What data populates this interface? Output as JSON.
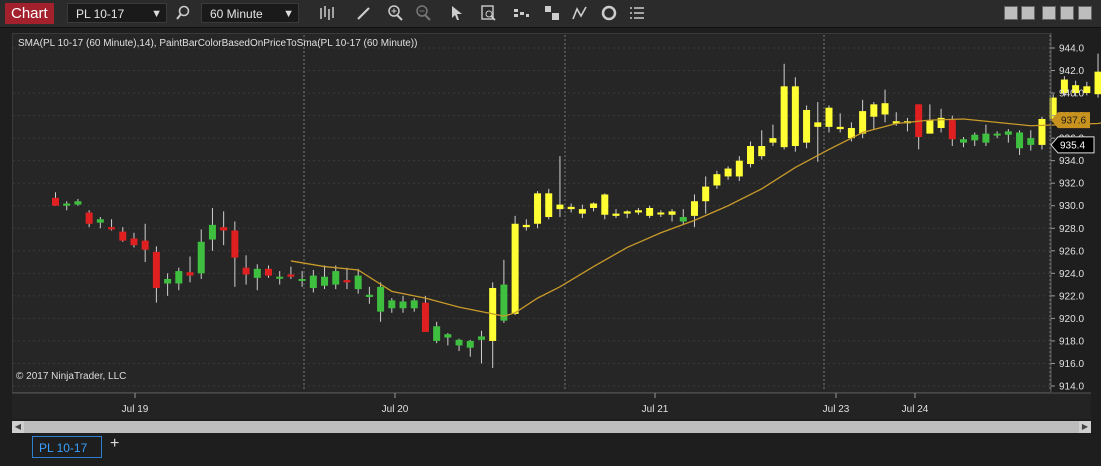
{
  "window": {
    "tab_label": "Chart"
  },
  "toolbar": {
    "instrument": "PL 10-17",
    "interval": "60 Minute",
    "icons": [
      "search-icon",
      "bar-style-icon",
      "draw-pencil-icon",
      "zoom-in-icon",
      "zoom-out-icon",
      "pointer-icon",
      "data-box-icon",
      "indicators-icon",
      "strategies-icon",
      "drawing-tools-icon",
      "properties-icon",
      "list-icon"
    ]
  },
  "chart": {
    "indicator_label": "SMA(PL 10-17 (60 Minute),14), PaintBarColorBasedOnPriceToSma(PL 10-17 (60 Minute))",
    "copyright": "© 2017 NinjaTrader, LLC",
    "y_ticks": [
      "944.0",
      "942.0",
      "940.0",
      "938.0",
      "936.0",
      "934.0",
      "932.0",
      "930.0",
      "928.0",
      "926.0",
      "924.0",
      "922.0",
      "920.0",
      "918.0",
      "916.0",
      "914.0"
    ],
    "x_labels": [
      "Jul 19",
      "Jul 20",
      "Jul 21",
      "Jul 23",
      "Jul 24"
    ],
    "sma_marker": "937.6",
    "last_price": "935.4",
    "colors": {
      "up": "#3fbf3f",
      "down": "#e02020",
      "above_sma": "#ffff33",
      "sma": "#c89a2a",
      "sma_marker_bg": "#c8921e",
      "last_price_bg": "#000000"
    }
  },
  "chart_data": {
    "type": "candlestick",
    "x": [
      "Jul 19",
      "Jul 20",
      "Jul 21",
      "Jul 23",
      "Jul 24"
    ],
    "ylim": [
      914,
      945
    ],
    "sma_period": 14,
    "last_price": 935.4,
    "sma_last": 937.6,
    "candles": [
      {
        "o": 930.7,
        "h": 931.2,
        "l": 930.0,
        "c": 930.0,
        "col": "down"
      },
      {
        "o": 930.0,
        "h": 930.4,
        "l": 929.6,
        "c": 930.2,
        "col": "up"
      },
      {
        "o": 930.1,
        "h": 930.6,
        "l": 930.0,
        "c": 930.4,
        "col": "up"
      },
      {
        "o": 929.4,
        "h": 929.6,
        "l": 928.1,
        "c": 928.4,
        "col": "down"
      },
      {
        "o": 928.5,
        "h": 929.0,
        "l": 928.0,
        "c": 928.8,
        "col": "up"
      },
      {
        "o": 928.1,
        "h": 928.8,
        "l": 927.8,
        "c": 927.9,
        "col": "down"
      },
      {
        "o": 927.7,
        "h": 928.1,
        "l": 926.8,
        "c": 926.9,
        "col": "down"
      },
      {
        "o": 927.1,
        "h": 927.6,
        "l": 926.3,
        "c": 926.5,
        "col": "down"
      },
      {
        "o": 926.9,
        "h": 928.4,
        "l": 925.0,
        "c": 926.1,
        "col": "down"
      },
      {
        "o": 925.9,
        "h": 926.4,
        "l": 921.4,
        "c": 922.7,
        "col": "down"
      },
      {
        "o": 923.1,
        "h": 924.0,
        "l": 922.0,
        "c": 923.5,
        "col": "up"
      },
      {
        "o": 923.1,
        "h": 924.5,
        "l": 922.5,
        "c": 924.2,
        "col": "up"
      },
      {
        "o": 924.1,
        "h": 925.5,
        "l": 923.2,
        "c": 923.8,
        "col": "down"
      },
      {
        "o": 924.0,
        "h": 927.9,
        "l": 923.5,
        "c": 926.8,
        "col": "up"
      },
      {
        "o": 927.0,
        "h": 929.8,
        "l": 926.0,
        "c": 928.3,
        "col": "up"
      },
      {
        "o": 928.1,
        "h": 929.5,
        "l": 926.5,
        "c": 927.8,
        "col": "down"
      },
      {
        "o": 927.8,
        "h": 928.6,
        "l": 922.8,
        "c": 925.4,
        "col": "down"
      },
      {
        "o": 924.5,
        "h": 925.6,
        "l": 923.0,
        "c": 923.9,
        "col": "down"
      },
      {
        "o": 923.6,
        "h": 924.8,
        "l": 922.5,
        "c": 924.4,
        "col": "up"
      },
      {
        "o": 924.4,
        "h": 924.7,
        "l": 923.6,
        "c": 923.8,
        "col": "down"
      },
      {
        "o": 923.6,
        "h": 924.2,
        "l": 923.0,
        "c": 923.7,
        "col": "up"
      },
      {
        "o": 923.9,
        "h": 924.6,
        "l": 923.5,
        "c": 923.7,
        "col": "down"
      },
      {
        "o": 923.5,
        "h": 924.2,
        "l": 922.8,
        "c": 923.4,
        "col": "up"
      },
      {
        "o": 922.7,
        "h": 924.3,
        "l": 922.3,
        "c": 923.8,
        "col": "up"
      },
      {
        "o": 922.9,
        "h": 924.7,
        "l": 922.6,
        "c": 923.7,
        "col": "up"
      },
      {
        "o": 923.0,
        "h": 924.7,
        "l": 922.6,
        "c": 924.2,
        "col": "up"
      },
      {
        "o": 923.2,
        "h": 924.5,
        "l": 922.6,
        "c": 923.4,
        "col": "down"
      },
      {
        "o": 922.6,
        "h": 924.4,
        "l": 922.2,
        "c": 923.8,
        "col": "up"
      },
      {
        "o": 921.9,
        "h": 922.8,
        "l": 921.3,
        "c": 922.1,
        "col": "up"
      },
      {
        "o": 920.6,
        "h": 923.2,
        "l": 919.7,
        "c": 922.8,
        "col": "up"
      },
      {
        "o": 920.9,
        "h": 921.8,
        "l": 920.5,
        "c": 921.6,
        "col": "up"
      },
      {
        "o": 920.9,
        "h": 922.0,
        "l": 920.5,
        "c": 921.5,
        "col": "up"
      },
      {
        "o": 920.9,
        "h": 921.8,
        "l": 920.6,
        "c": 921.6,
        "col": "up"
      },
      {
        "o": 921.4,
        "h": 922.0,
        "l": 919.2,
        "c": 918.8,
        "col": "down"
      },
      {
        "o": 918.0,
        "h": 919.7,
        "l": 917.8,
        "c": 919.3,
        "col": "up"
      },
      {
        "o": 918.3,
        "h": 918.7,
        "l": 917.6,
        "c": 918.6,
        "col": "up"
      },
      {
        "o": 917.6,
        "h": 918.2,
        "l": 917.1,
        "c": 918.1,
        "col": "up"
      },
      {
        "o": 917.4,
        "h": 918.1,
        "l": 916.6,
        "c": 918.0,
        "col": "up"
      },
      {
        "o": 918.1,
        "h": 918.9,
        "l": 916.0,
        "c": 918.4,
        "col": "up"
      },
      {
        "o": 918.0,
        "h": 923.2,
        "l": 915.6,
        "c": 922.7,
        "col": "above"
      },
      {
        "o": 919.8,
        "h": 925.2,
        "l": 919.6,
        "c": 923.0,
        "col": "up"
      },
      {
        "o": 920.4,
        "h": 929.1,
        "l": 920.3,
        "c": 928.4,
        "col": "above"
      },
      {
        "o": 928.1,
        "h": 928.8,
        "l": 927.8,
        "c": 928.3,
        "col": "above"
      },
      {
        "o": 928.4,
        "h": 931.3,
        "l": 928.0,
        "c": 931.1,
        "col": "above"
      },
      {
        "o": 929.0,
        "h": 931.5,
        "l": 928.8,
        "c": 931.1,
        "col": "above"
      },
      {
        "o": 929.7,
        "h": 934.4,
        "l": 929.0,
        "c": 930.1,
        "col": "above"
      },
      {
        "o": 929.7,
        "h": 930.2,
        "l": 929.4,
        "c": 929.9,
        "col": "above"
      },
      {
        "o": 929.7,
        "h": 930.1,
        "l": 928.9,
        "c": 929.3,
        "col": "above"
      },
      {
        "o": 929.8,
        "h": 930.3,
        "l": 929.5,
        "c": 930.2,
        "col": "above"
      },
      {
        "o": 929.2,
        "h": 931.1,
        "l": 928.8,
        "c": 931.0,
        "col": "above"
      },
      {
        "o": 929.1,
        "h": 929.7,
        "l": 928.9,
        "c": 929.3,
        "col": "above"
      },
      {
        "o": 929.3,
        "h": 929.6,
        "l": 928.9,
        "c": 929.5,
        "col": "above"
      },
      {
        "o": 929.4,
        "h": 929.8,
        "l": 929.2,
        "c": 929.6,
        "col": "above"
      },
      {
        "o": 929.1,
        "h": 930.0,
        "l": 928.9,
        "c": 929.8,
        "col": "above"
      },
      {
        "o": 929.4,
        "h": 929.6,
        "l": 929.0,
        "c": 929.4,
        "col": "above"
      },
      {
        "o": 929.2,
        "h": 929.7,
        "l": 928.6,
        "c": 929.5,
        "col": "above"
      },
      {
        "o": 928.6,
        "h": 929.7,
        "l": 928.3,
        "c": 929.0,
        "col": "up"
      },
      {
        "o": 929.1,
        "h": 931.0,
        "l": 928.1,
        "c": 930.4,
        "col": "above"
      },
      {
        "o": 930.4,
        "h": 932.6,
        "l": 929.3,
        "c": 931.7,
        "col": "above"
      },
      {
        "o": 931.8,
        "h": 933.1,
        "l": 931.5,
        "c": 932.8,
        "col": "above"
      },
      {
        "o": 932.6,
        "h": 933.5,
        "l": 932.3,
        "c": 933.3,
        "col": "above"
      },
      {
        "o": 932.6,
        "h": 934.4,
        "l": 932.2,
        "c": 934.0,
        "col": "above"
      },
      {
        "o": 933.7,
        "h": 935.7,
        "l": 933.4,
        "c": 935.3,
        "col": "above"
      },
      {
        "o": 934.4,
        "h": 936.7,
        "l": 934.1,
        "c": 935.3,
        "col": "above"
      },
      {
        "o": 935.6,
        "h": 937.2,
        "l": 935.3,
        "c": 936.0,
        "col": "above"
      },
      {
        "o": 935.2,
        "h": 942.6,
        "l": 935.0,
        "c": 940.6,
        "col": "above"
      },
      {
        "o": 935.3,
        "h": 941.4,
        "l": 934.8,
        "c": 940.6,
        "col": "above"
      },
      {
        "o": 935.6,
        "h": 938.9,
        "l": 935.1,
        "c": 938.5,
        "col": "above"
      },
      {
        "o": 937.0,
        "h": 939.2,
        "l": 933.9,
        "c": 937.4,
        "col": "above"
      },
      {
        "o": 937.0,
        "h": 938.9,
        "l": 936.5,
        "c": 938.7,
        "col": "above"
      },
      {
        "o": 937.0,
        "h": 938.2,
        "l": 936.5,
        "c": 936.8,
        "col": "above"
      },
      {
        "o": 936.0,
        "h": 937.4,
        "l": 935.7,
        "c": 936.9,
        "col": "above"
      },
      {
        "o": 936.4,
        "h": 939.4,
        "l": 936.0,
        "c": 938.4,
        "col": "above"
      },
      {
        "o": 937.9,
        "h": 939.2,
        "l": 936.8,
        "c": 939.0,
        "col": "above"
      },
      {
        "o": 938.1,
        "h": 940.3,
        "l": 937.4,
        "c": 939.1,
        "col": "above"
      },
      {
        "o": 937.3,
        "h": 938.3,
        "l": 937.1,
        "c": 937.5,
        "col": "above"
      },
      {
        "o": 937.4,
        "h": 937.8,
        "l": 936.6,
        "c": 937.5,
        "col": "above"
      },
      {
        "o": 939.0,
        "h": 939.0,
        "l": 935.0,
        "c": 936.1,
        "col": "down"
      },
      {
        "o": 937.6,
        "h": 939.0,
        "l": 936.4,
        "c": 936.4,
        "col": "above"
      },
      {
        "o": 936.9,
        "h": 938.6,
        "l": 936.5,
        "c": 937.8,
        "col": "above"
      },
      {
        "o": 937.6,
        "h": 938.0,
        "l": 935.3,
        "c": 935.9,
        "col": "down"
      },
      {
        "o": 935.6,
        "h": 936.1,
        "l": 935.2,
        "c": 935.9,
        "col": "up"
      },
      {
        "o": 935.8,
        "h": 936.5,
        "l": 935.3,
        "c": 936.3,
        "col": "up"
      },
      {
        "o": 935.6,
        "h": 937.2,
        "l": 935.3,
        "c": 936.4,
        "col": "up"
      },
      {
        "o": 936.3,
        "h": 936.6,
        "l": 936.0,
        "c": 936.4,
        "col": "up"
      },
      {
        "o": 936.6,
        "h": 936.8,
        "l": 935.6,
        "c": 936.3,
        "col": "up"
      },
      {
        "o": 935.1,
        "h": 936.7,
        "l": 934.5,
        "c": 936.5,
        "col": "up"
      },
      {
        "o": 935.4,
        "h": 936.7,
        "l": 934.9,
        "c": 936.0,
        "col": "up"
      },
      {
        "o": 935.4,
        "h": 937.9,
        "l": 935.0,
        "c": 937.7,
        "col": "above"
      },
      {
        "o": 937.7,
        "h": 939.9,
        "l": 937.4,
        "c": 939.6,
        "col": "above"
      },
      {
        "o": 940.0,
        "h": 941.5,
        "l": 939.7,
        "c": 941.2,
        "col": "above"
      },
      {
        "o": 940.0,
        "h": 941.1,
        "l": 939.7,
        "c": 940.7,
        "col": "above"
      },
      {
        "o": 940.0,
        "h": 941.0,
        "l": 939.8,
        "c": 940.6,
        "col": "above"
      },
      {
        "o": 939.9,
        "h": 943.5,
        "l": 939.6,
        "c": 941.9,
        "col": "above"
      },
      {
        "o": 941.9,
        "h": 941.9,
        "l": 936.5,
        "c": 937.6,
        "col": "above"
      },
      {
        "o": 937.4,
        "h": 939.4,
        "l": 935.0,
        "c": 935.3,
        "col": "up"
      },
      {
        "o": 935.1,
        "h": 935.7,
        "l": 934.4,
        "c": 936.6,
        "col": "up"
      },
      {
        "o": 935.5,
        "h": 936.6,
        "l": 934.9,
        "c": 936.5,
        "col": "down"
      }
    ],
    "sma": [
      [
        21,
        925.1
      ],
      [
        24,
        924.6
      ],
      [
        27,
        924.3
      ],
      [
        30,
        922.4
      ],
      [
        33,
        921.8
      ],
      [
        36,
        921.0
      ],
      [
        39,
        920.4
      ],
      [
        40,
        920.2
      ],
      [
        41,
        920.5
      ],
      [
        43,
        921.8
      ],
      [
        45,
        922.8
      ],
      [
        48,
        924.6
      ],
      [
        51,
        926.3
      ],
      [
        54,
        927.6
      ],
      [
        57,
        928.7
      ],
      [
        60,
        930.0
      ],
      [
        63,
        931.5
      ],
      [
        66,
        933.4
      ],
      [
        69,
        935.0
      ],
      [
        72,
        936.5
      ],
      [
        75,
        937.3
      ],
      [
        78,
        937.6
      ],
      [
        81,
        937.7
      ],
      [
        84,
        937.4
      ],
      [
        87,
        937.1
      ],
      [
        90,
        937.2
      ],
      [
        93,
        937.3
      ],
      [
        96,
        937.8
      ],
      [
        99,
        937.6
      ]
    ]
  }
}
